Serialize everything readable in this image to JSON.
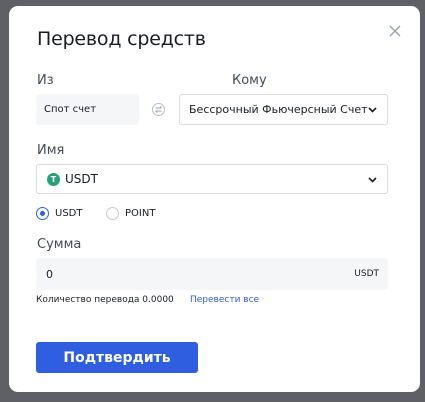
{
  "modal": {
    "title": "Перевод средств",
    "from": {
      "label": "Из",
      "value": "Спот счет"
    },
    "to": {
      "label": "Кому",
      "value": "Бессрочный Фьючерсный Счет"
    },
    "name": {
      "label": "Имя",
      "coin_letter": "T",
      "value": "USDT"
    },
    "radio_options": [
      {
        "label": "USDT",
        "selected": true
      },
      {
        "label": "POINT",
        "selected": false
      }
    ],
    "amount": {
      "label": "Сумма",
      "value": "0",
      "unit": "USDT"
    },
    "transfer_quantity": "Количество перевода 0.0000",
    "transfer_all_link": "Перевести все",
    "confirm_button": "Подтвердить"
  },
  "colors": {
    "accent": "#2f5fe0",
    "usdt_green": "#26a17b",
    "overlay": "#5e6066"
  },
  "icons": {
    "close": "close-icon",
    "swap": "swap-icon",
    "chevron": "chevron-down-icon",
    "coin": "usdt-coin-icon"
  }
}
